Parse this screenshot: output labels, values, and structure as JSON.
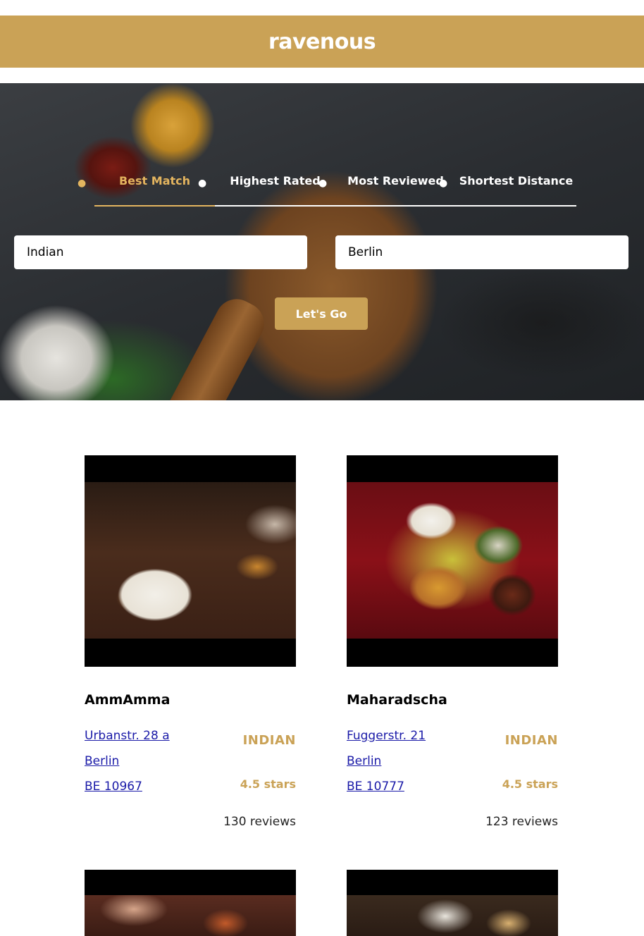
{
  "header": {
    "logo": "ravenous"
  },
  "search": {
    "sort_options": [
      {
        "label": "Best Match",
        "active": true
      },
      {
        "label": "Highest Rated",
        "active": false
      },
      {
        "label": "Most Reviewed",
        "active": false
      },
      {
        "label": "Shortest Distance",
        "active": false
      }
    ],
    "term_value": "Indian",
    "location_value": "Berlin",
    "submit_label": "Let's Go"
  },
  "businesses": [
    {
      "name": "AmmAmma",
      "address": "Urbanstr. 28 a",
      "city": "Berlin",
      "state_zip": "BE 10967",
      "category": "INDIAN",
      "rating": "4.5 stars",
      "reviews": "130 reviews"
    },
    {
      "name": "Maharadscha",
      "address": "Fuggerstr. 21",
      "city": "Berlin",
      "state_zip": "BE 10777",
      "category": "INDIAN",
      "rating": "4.5 stars",
      "reviews": "123 reviews"
    }
  ],
  "colors": {
    "accent": "#caa256",
    "active_sort": "#e4b55f",
    "link": "#1a1aa8"
  }
}
